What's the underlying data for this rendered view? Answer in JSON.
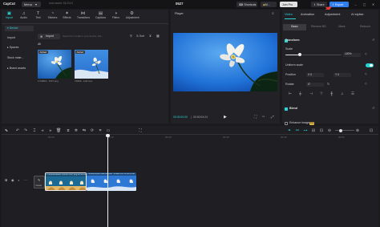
{
  "titlebar": {
    "app_name": "CapCut",
    "menu_label": "Menu",
    "autosave_text": "Auto saved: 18:23:41",
    "project_title": "0527",
    "shortcuts_label": "Shortcuts",
    "membership_label": "M...",
    "join_pro_label": "Join Pro",
    "share_label": "Share",
    "export_label": "Export",
    "accent_color": "#2f7ff0"
  },
  "media": {
    "tabs": [
      {
        "label": "Import",
        "icon": "import-icon"
      },
      {
        "label": "Audio",
        "icon": "audio-icon"
      },
      {
        "label": "Text",
        "icon": "text-icon"
      },
      {
        "label": "Stickers",
        "icon": "sticker-icon"
      },
      {
        "label": "Effects",
        "icon": "effects-icon"
      },
      {
        "label": "Transitions",
        "icon": "transitions-icon"
      },
      {
        "label": "Captions",
        "icon": "captions-icon"
      },
      {
        "label": "Filters",
        "icon": "filters-icon"
      },
      {
        "label": "Adjustment",
        "icon": "adjustment-icon"
      }
    ],
    "sidebar": [
      {
        "label": "▾ Device"
      },
      {
        "label": "Import"
      },
      {
        "label": "▸ Spaces"
      },
      {
        "label": "Stock mate..."
      },
      {
        "label": "▸ Brand assets"
      }
    ],
    "import_button": "Import",
    "search_placeholder": "Search for media in your device, File...",
    "filter_all": "All",
    "sort_label": "Sort",
    "thumbs": [
      {
        "badge": "Added",
        "caption": "1742816...7047.png"
      },
      {
        "badge": "Added",
        "caption": "V0309...mall.mov"
      }
    ],
    "active_color": "#27d3d3"
  },
  "player": {
    "title": "Player",
    "current_time": "00:00:00:00",
    "total_time": "00:00:04:24"
  },
  "properties": {
    "tabs": [
      "Video",
      "Animation",
      "Adjustment",
      "AI stylize"
    ],
    "subtabs": [
      "Basic",
      "Remove BG",
      "Mask",
      "Retouch"
    ],
    "transform_label": "Transform",
    "scale_label": "Scale",
    "scale_value": "100%",
    "uniform_scale_label": "Uniform scale",
    "position_label": "Position",
    "position_x_label": "X",
    "position_x": "0",
    "position_y_label": "Y",
    "position_y": "0",
    "rotate_label": "Rotate",
    "rotate_value": "0°",
    "blend_label": "Blend",
    "enhance_label": "Enhance image",
    "enhance_badge": "Pro",
    "scale_fraction": 0.25
  },
  "timeline": {
    "ticks": [
      "00:00",
      "00:10",
      "00:20",
      "00:30",
      "00:40",
      "00:50",
      "01:00"
    ],
    "cover_label": "Cover",
    "clip1_label": "1742816899897-0f65257047.png  00:00:05:00",
    "clip2_label": "V10309-69497890-9b1eb2...small.mov  00:00:05:00"
  }
}
